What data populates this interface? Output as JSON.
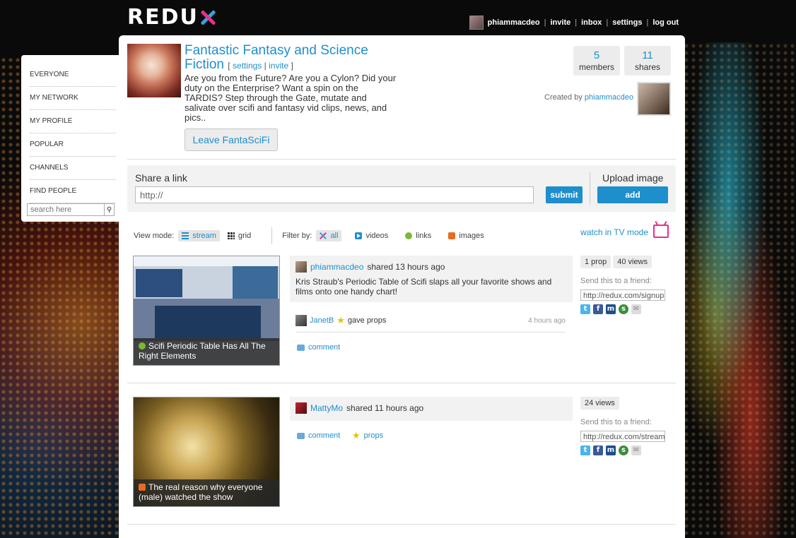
{
  "brand": {
    "logo_text": "REDU"
  },
  "usernav": {
    "username": "phiammacdeo",
    "invite": "invite",
    "inbox": "inbox",
    "settings": "settings",
    "logout": "log out",
    "sep": "|"
  },
  "sidebar": {
    "items": [
      {
        "label": "EVERYONE"
      },
      {
        "label": "MY NETWORK"
      },
      {
        "label": "MY PROFILE"
      },
      {
        "label": "POPULAR"
      },
      {
        "label": "CHANNELS"
      },
      {
        "label": "FIND PEOPLE"
      }
    ],
    "search_placeholder": "search here"
  },
  "group": {
    "title": "Fantastic Fantasy and Science Fiction",
    "settings_link": "settings",
    "invite_link": "invite",
    "bracket_open": "[",
    "bracket_close": "]",
    "pipe": "|",
    "description": "Are you from the Future? Are you a Cylon? Did your duty on the Enterprise? Want a spin on the TARDIS? Step through the Gate, mutate and salivate over scifi and fantasy vid clips, news, and pics..",
    "leave_button": "Leave FantaSciFi",
    "members_count": "5",
    "members_label": "members",
    "shares_count": "11",
    "shares_label": "shares",
    "created_by_label": "Created by",
    "created_by_user": "phiammacdeo"
  },
  "share": {
    "label": "Share a link",
    "input_value": "http://",
    "submit": "submit",
    "upload_label": "Upload image",
    "add": "add"
  },
  "viewbar": {
    "view_mode_label": "View mode:",
    "stream": "stream",
    "grid": "grid",
    "filter_label": "Filter by:",
    "all": "all",
    "videos": "videos",
    "links": "links",
    "images": "images",
    "tv_mode": "watch in TV mode"
  },
  "posts": [
    {
      "thumb_caption": "Scifi Periodic Table Has All The Right Elements",
      "user": "phiammacdeo",
      "shared_text": "shared 13 hours ago",
      "text": "Kris Straub's Periodic Table of Scifi slaps all your favorite shows and films onto one handy chart!",
      "props_user": "JanetB",
      "props_text": "gave props",
      "props_time": "4 hours ago",
      "comment": "comment",
      "props_count": "1 prop",
      "views": "40 views",
      "send_label": "Send this to a friend:",
      "send_url": "http://redux.com/signup"
    },
    {
      "thumb_caption": "The real reason why everyone (male) watched the show",
      "user": "MattyMo",
      "shared_text": "shared 11 hours ago",
      "comment": "comment",
      "props": "props",
      "views": "24 views",
      "send_label": "Send this to a friend:",
      "send_url": "http://redux.com/stream"
    }
  ],
  "social_icons": [
    "twitter-icon",
    "facebook-icon",
    "myspace-icon",
    "stumbleupon-icon",
    "email-icon"
  ],
  "colors": {
    "accent": "#1f8ecc",
    "logo_x_blue": "#2ba8e0",
    "logo_x_pink": "#e8308a",
    "tv_icon": "#e8308a"
  }
}
